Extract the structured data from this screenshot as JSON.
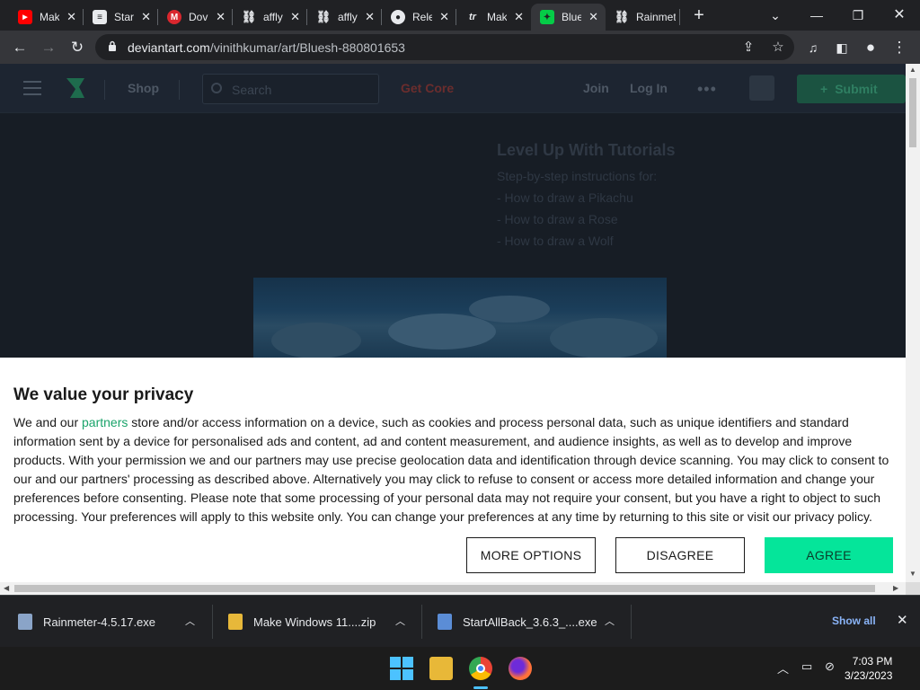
{
  "browser": {
    "tabs": [
      {
        "label": "Mak",
        "icon": "youtube-icon",
        "color": "#ff0000"
      },
      {
        "label": "Star",
        "icon": "document-icon",
        "color": "#e8eaed"
      },
      {
        "label": "Dov",
        "icon": "mega-icon",
        "color": "#d9272e"
      },
      {
        "label": "affly",
        "icon": "link-icon",
        "color": "#e8eaed"
      },
      {
        "label": "affly",
        "icon": "link-icon",
        "color": "#e8eaed"
      },
      {
        "label": "Rele",
        "icon": "github-icon",
        "color": "#e8eaed"
      },
      {
        "label": "Mak",
        "icon": "tr-icon",
        "color": "#e8eaed"
      },
      {
        "label": "Blue",
        "icon": "deviantart-icon",
        "color": "#05cc47",
        "active": true
      },
      {
        "label": "Rainmet",
        "icon": "link-icon",
        "color": "#e8eaed"
      }
    ],
    "new_tab": "+",
    "url_host": "deviantart.com",
    "url_path": "/vinithkumar/art/Bluesh-880801653"
  },
  "site": {
    "nav": {
      "shop": "Shop",
      "search_placeholder": "Search",
      "get_core": "Get Core",
      "join": "Join",
      "login": "Log In",
      "more": "•••",
      "submit": "Submit"
    },
    "tutorials": {
      "heading": "Level Up With Tutorials",
      "sub": "Step-by-step instructions for:",
      "items": [
        "- How to draw a Pikachu",
        "- How to draw a Rose",
        "- How to draw a Wolf"
      ]
    }
  },
  "consent": {
    "title": "We value your privacy",
    "text_before_link": "We and our ",
    "link": "partners",
    "text_after_link": " store and/or access information on a device, such as cookies and process personal data, such as unique identifiers and standard information sent by a device for personalised ads and content, ad and content measurement, and audience insights, as well as to develop and improve products. With your permission we and our partners may use precise geolocation data and identification through device scanning. You may click to consent to our and our partners' processing as described above. Alternatively you may click to refuse to consent or access more detailed information and change your preferences before consenting. Please note that some processing of your personal data may not require your consent, but you have a right to object to such processing. Your preferences will apply to this website only. You can change your preferences at any time by returning to this site or visit our privacy policy.",
    "more_options": "MORE OPTIONS",
    "disagree": "DISAGREE",
    "agree": "AGREE",
    "agree_color": "#05e59a"
  },
  "downloads": {
    "items": [
      "Rainmeter-4.5.17.exe",
      "Make Windows 11....zip",
      "StartAllBack_3.6.3_....exe"
    ],
    "show_all": "Show all"
  },
  "taskbar": {
    "time": "7:03 PM",
    "date": "3/23/2023"
  }
}
